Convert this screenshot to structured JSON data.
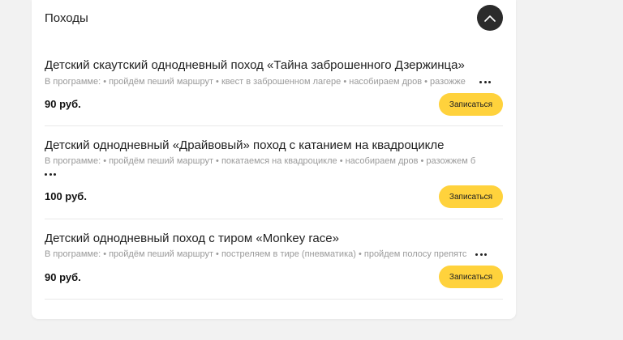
{
  "section": {
    "title": "Походы"
  },
  "items": [
    {
      "title": "Детский скаутский однодневный поход «Тайна заброшенного Дзержинца»",
      "program": "В программе: • пройдём пеший маршрут • квест в заброшенном лагере • насобираем дров • разожже",
      "price": "90 руб.",
      "button": "Записаться"
    },
    {
      "title": "Детский однодневный «Драйвовый» поход с катанием на квадроцикле",
      "program": "В программе: • пройдём пеший маршрут • покатаемся на квадроцикле • насобираем дров • разожжем б",
      "price": "100 руб.",
      "button": "Записаться"
    },
    {
      "title": "Детский однодневный поход с тиром «Monkey race»",
      "program": "В программе: • пройдём пеший маршрут • постреляем в тире (пневматика) • пройдем полосу препятс",
      "price": "90 руб.",
      "button": "Записаться"
    }
  ],
  "icons": {
    "collapse": "chevron-up-icon",
    "more": "more-dots-icon"
  },
  "colors": {
    "accent": "#ffd23c",
    "collapse_button": "#2b2b2b"
  }
}
